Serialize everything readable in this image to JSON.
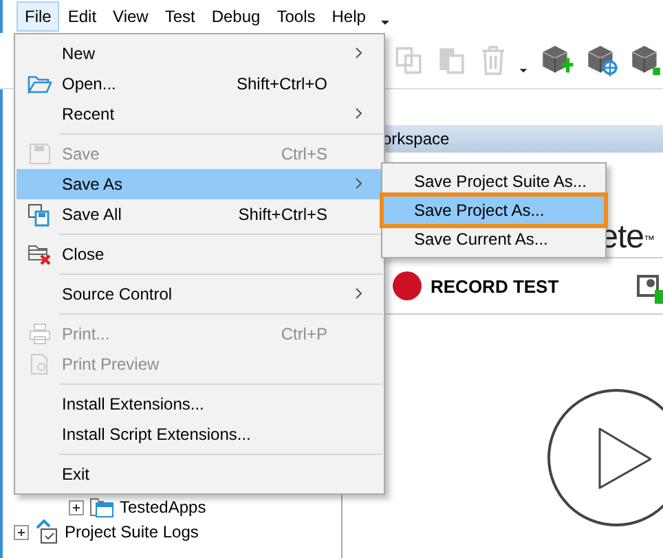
{
  "menubar": [
    {
      "label": "File",
      "selected": true
    },
    {
      "label": "Edit",
      "selected": false
    },
    {
      "label": "View",
      "selected": false
    },
    {
      "label": "Test",
      "selected": false
    },
    {
      "label": "Debug",
      "selected": false
    },
    {
      "label": "Tools",
      "selected": false
    },
    {
      "label": "Help",
      "selected": false
    }
  ],
  "file_menu": [
    {
      "kind": "item",
      "label": "New",
      "disabled": false,
      "selected": false,
      "submenu": true
    },
    {
      "kind": "item",
      "label": "Open...",
      "shortcut": "Shift+Ctrl+O",
      "disabled": false,
      "selected": false,
      "submenu": false
    },
    {
      "kind": "item",
      "label": "Recent",
      "disabled": false,
      "selected": false,
      "submenu": true
    },
    {
      "kind": "separator"
    },
    {
      "kind": "item",
      "label": "Save",
      "shortcut": "Ctrl+S",
      "disabled": true,
      "selected": false,
      "submenu": false
    },
    {
      "kind": "item",
      "label": "Save As",
      "disabled": false,
      "selected": true,
      "submenu": true
    },
    {
      "kind": "item",
      "label": "Save All",
      "shortcut": "Shift+Ctrl+S",
      "disabled": false,
      "selected": false,
      "submenu": false
    },
    {
      "kind": "separator"
    },
    {
      "kind": "item",
      "label": "Close",
      "disabled": false,
      "selected": false,
      "submenu": false
    },
    {
      "kind": "separator"
    },
    {
      "kind": "item",
      "label": "Source Control",
      "disabled": false,
      "selected": false,
      "submenu": true
    },
    {
      "kind": "separator"
    },
    {
      "kind": "item",
      "label": "Print...",
      "shortcut": "Ctrl+P",
      "disabled": true,
      "selected": false,
      "submenu": false
    },
    {
      "kind": "item",
      "label": "Print Preview",
      "disabled": true,
      "selected": false,
      "submenu": false
    },
    {
      "kind": "separator"
    },
    {
      "kind": "item",
      "label": "Install Extensions...",
      "disabled": false,
      "selected": false,
      "submenu": false
    },
    {
      "kind": "item",
      "label": "Install Script Extensions...",
      "disabled": false,
      "selected": false,
      "submenu": false
    },
    {
      "kind": "separator"
    },
    {
      "kind": "item",
      "label": "Exit",
      "disabled": false,
      "selected": false,
      "submenu": false
    }
  ],
  "save_as_submenu": [
    {
      "label": "Save Project Suite As...",
      "selected": false,
      "highlighted": false
    },
    {
      "label": "Save Project As...",
      "selected": true,
      "highlighted": true
    },
    {
      "label": "Save Current As...",
      "selected": false,
      "highlighted": false
    }
  ],
  "tree": [
    {
      "children": [
        {
          "label": "TestedApps",
          "expanded": false
        }
      ]
    },
    {
      "label": "Project Suite Logs",
      "expanded": false
    }
  ],
  "workspace": {
    "tab": "orkspace",
    "logo": "ete",
    "trademark": "™",
    "record_button": "RECORD TEST"
  }
}
